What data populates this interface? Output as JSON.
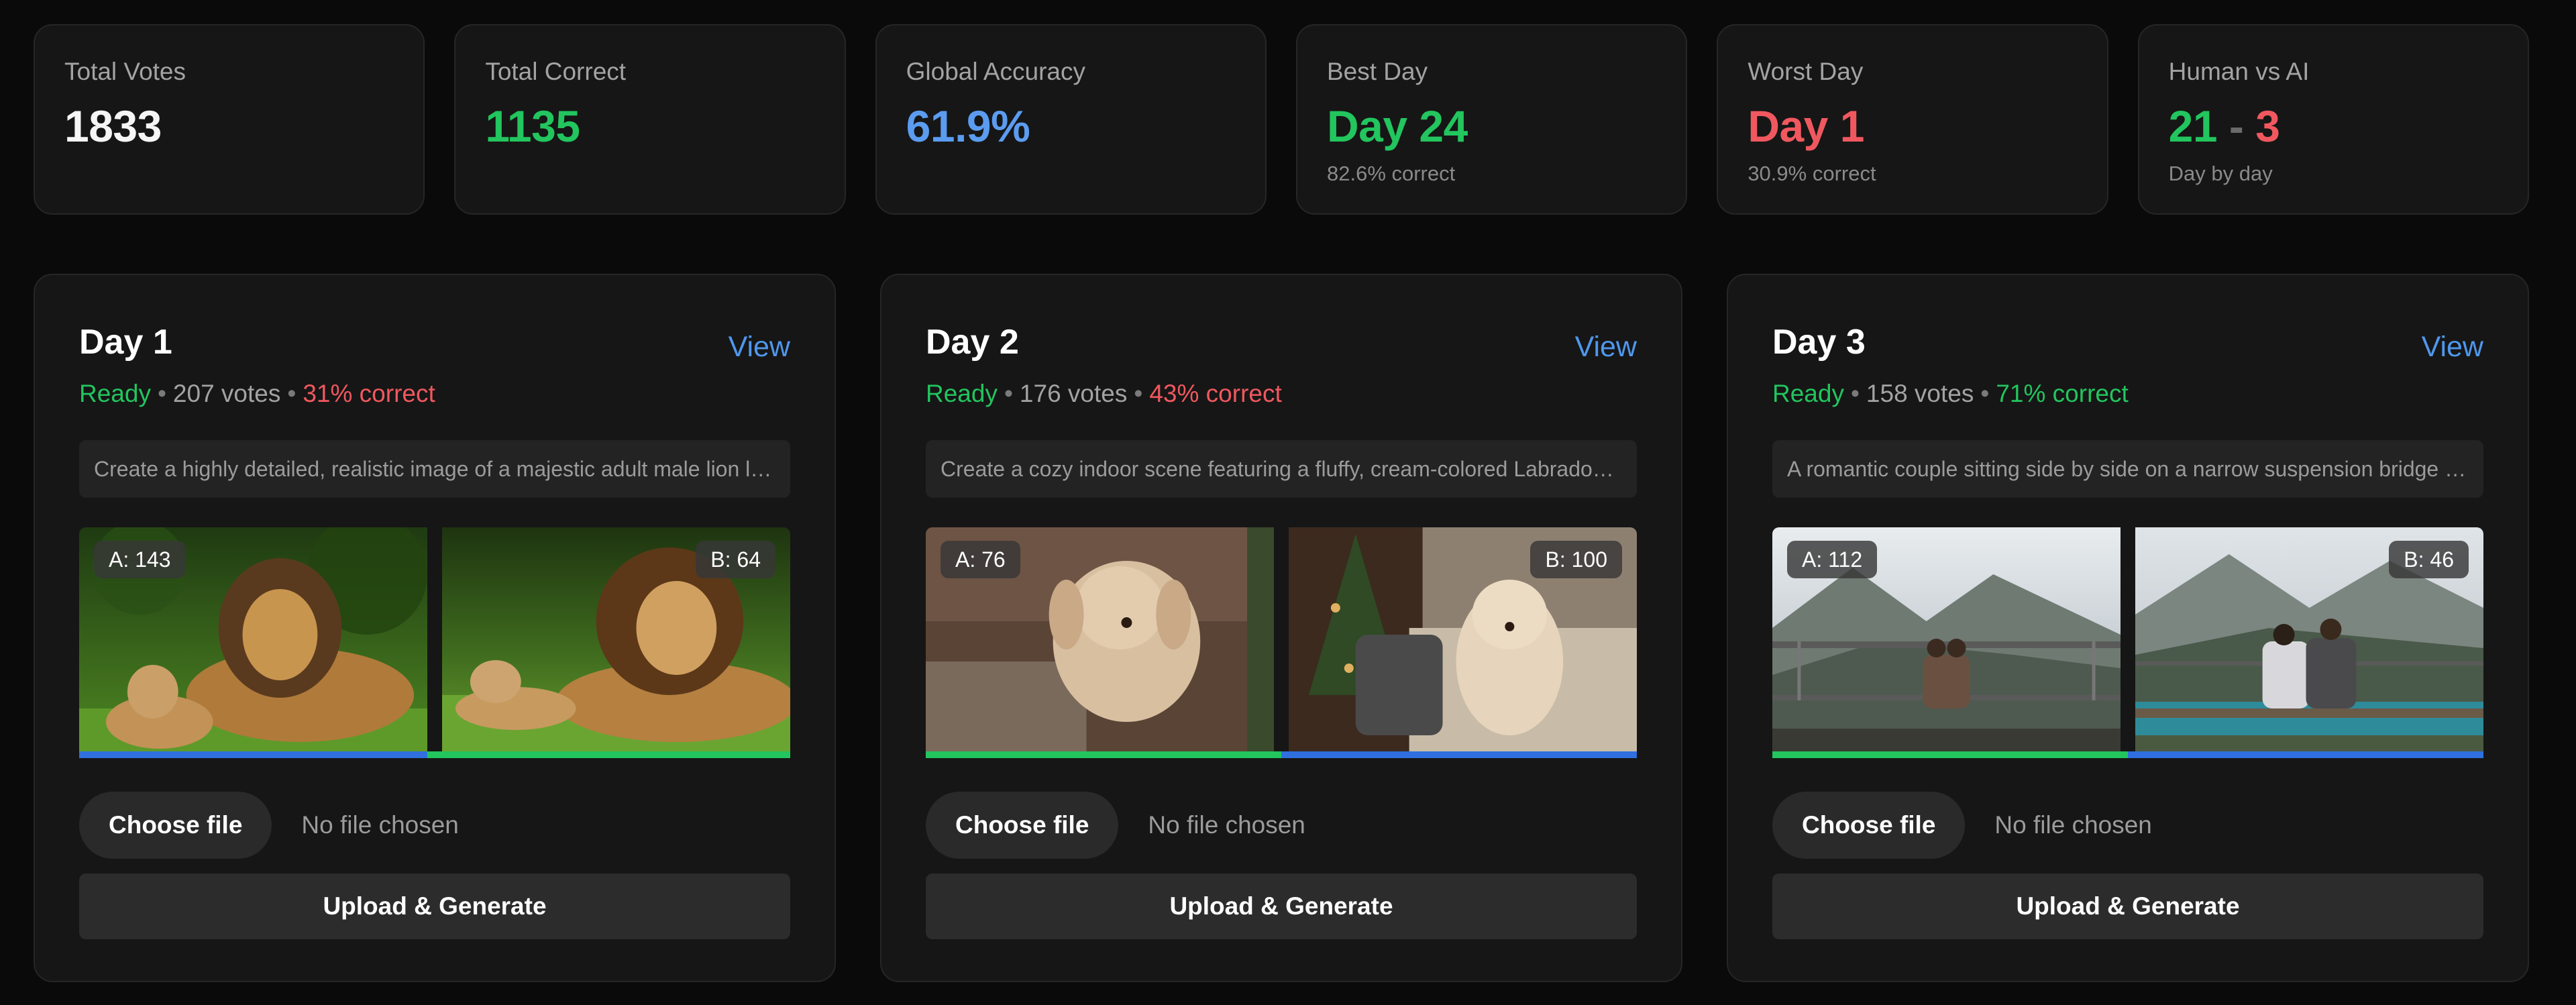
{
  "stats": [
    {
      "label": "Total Votes",
      "value": "1833",
      "color": "#f5f5f5"
    },
    {
      "label": "Total Correct",
      "value": "1135",
      "color": "#22c55e"
    },
    {
      "label": "Global Accuracy",
      "value": "61.9%",
      "color": "#5b9cf0"
    },
    {
      "label": "Best Day",
      "value": "Day 24",
      "sub": "82.6% correct",
      "color": "#22c55e"
    },
    {
      "label": "Worst Day",
      "value": "Day 1",
      "sub": "30.9% correct",
      "color": "#f0585f"
    },
    {
      "label": "Human vs AI",
      "human": "21",
      "separator": "-",
      "ai": "3",
      "sub": "Day by day"
    }
  ],
  "days": [
    {
      "title": "Day 1",
      "view_label": "View",
      "status": "Ready",
      "votes": "207 votes",
      "accuracy": "31% correct",
      "accuracy_color": "#f0585f",
      "prompt": "Create a highly detailed, realistic image of a majestic adult male lion lying on lush green grass beside a lion cub",
      "badge_a": "A: 143",
      "badge_b": "B: 64",
      "vote_share_a": 0.49,
      "bar_a_color": "#2f6fe0",
      "bar_b_color": "#22c55e",
      "image_a": "lion-photo",
      "image_b": "lion-photo",
      "choose_label": "Choose file",
      "no_file_label": "No file chosen",
      "upload_label": "Upload & Generate"
    },
    {
      "title": "Day 2",
      "view_label": "View",
      "status": "Ready",
      "votes": "176 votes",
      "accuracy": "43% correct",
      "accuracy_color": "#f0585f",
      "prompt": "Create a cozy indoor scene featuring a fluffy, cream-colored Labradoodle puppy sitting on a couch with holiday decorations",
      "badge_a": "A: 76",
      "badge_b": "B: 100",
      "vote_share_a": 0.5,
      "bar_a_color": "#22c55e",
      "bar_b_color": "#2f6fe0",
      "image_a": "puppy-photo",
      "image_b": "puppy-photo",
      "choose_label": "Choose file",
      "no_file_label": "No file chosen",
      "upload_label": "Upload & Generate"
    },
    {
      "title": "Day 3",
      "view_label": "View",
      "status": "Ready",
      "votes": "158 votes",
      "accuracy": "71% correct",
      "accuracy_color": "#22c55e",
      "prompt": "A romantic couple sitting side by side on a narrow suspension bridge overlooking a mountain lake",
      "badge_a": "A: 112",
      "badge_b": "B: 46",
      "vote_share_a": 0.5,
      "bar_a_color": "#22c55e",
      "bar_b_color": "#2f6fe0",
      "image_a": "bridge-photo",
      "image_b": "bridge-photo",
      "choose_label": "Choose file",
      "no_file_label": "No file chosen",
      "upload_label": "Upload & Generate"
    }
  ]
}
